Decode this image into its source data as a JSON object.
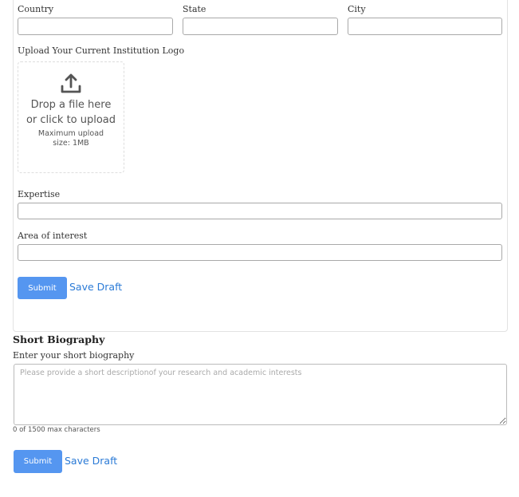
{
  "location": {
    "country_label": "Country",
    "state_label": "State",
    "city_label": "City"
  },
  "upload": {
    "label": "Upload Your Current Institution Logo",
    "drop_text": "Drop a file here or click to upload",
    "max_size": "Maximum upload size: 1MB",
    "icon": "upload-icon"
  },
  "expertise_label": "Expertise",
  "interest_label": "Area of interest",
  "form_actions": {
    "submit": "Submit",
    "save_draft": "Save Draft"
  },
  "biography": {
    "title": "Short Biography",
    "label": "Enter your short biography",
    "placeholder": "Please provide a short descriptionof your research and academic interests",
    "counter": "0 of 1500 max characters",
    "submit": "Submit",
    "save_draft": "Save Draft"
  }
}
